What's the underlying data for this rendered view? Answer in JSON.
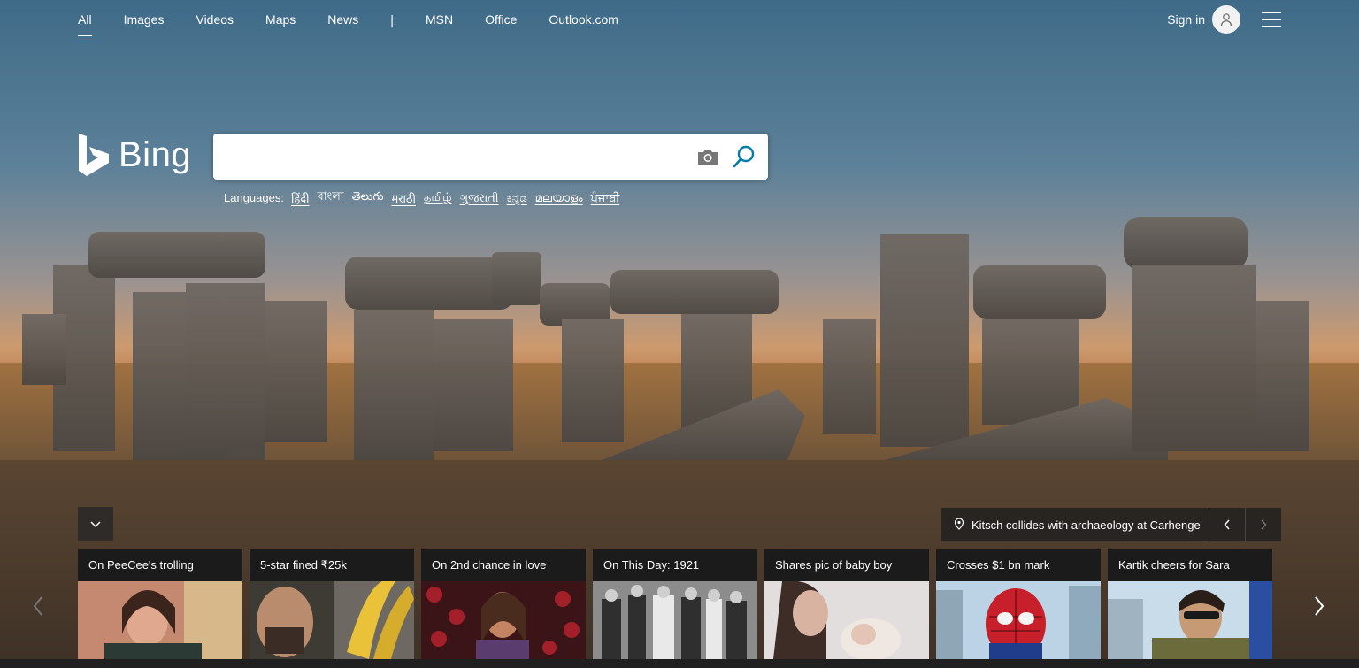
{
  "nav": {
    "items": [
      {
        "label": "All",
        "active": true
      },
      {
        "label": "Images"
      },
      {
        "label": "Videos"
      },
      {
        "label": "Maps"
      },
      {
        "label": "News"
      }
    ],
    "separator": "|",
    "extra": [
      {
        "label": "MSN"
      },
      {
        "label": "Office"
      },
      {
        "label": "Outlook.com"
      }
    ]
  },
  "header": {
    "signin_label": "Sign in",
    "avatar_icon": "user-icon",
    "menu_icon": "hamburger-menu-icon"
  },
  "logo": {
    "text": "Bing"
  },
  "search": {
    "value": "",
    "placeholder": "",
    "camera_icon": "camera-icon",
    "search_icon": "search-icon"
  },
  "languages": {
    "label": "Languages:",
    "items": [
      "हिंदी",
      "বাংলা",
      "తెలుగు",
      "मराठी",
      "தமிழ்",
      "ગુજરાતી",
      "ಕನ್ನಡ",
      "മലയാളം",
      "ਪੰਜਾਬੀ"
    ]
  },
  "background": {
    "caption": "Kitsch collides with archaeology at Carhenge",
    "location_icon": "location-pin-icon"
  },
  "carousel": {
    "cards": [
      {
        "title": "On PeeCee's trolling"
      },
      {
        "title": "5-star fined ₹25k"
      },
      {
        "title": "On 2nd chance in love"
      },
      {
        "title": "On This Day: 1921"
      },
      {
        "title": "Shares pic of baby boy"
      },
      {
        "title": "Crosses $1 bn mark"
      },
      {
        "title": "Kartik cheers for Sara"
      }
    ]
  },
  "colors": {
    "accent": "#007daa",
    "card_bg": "#1b1b1b"
  }
}
